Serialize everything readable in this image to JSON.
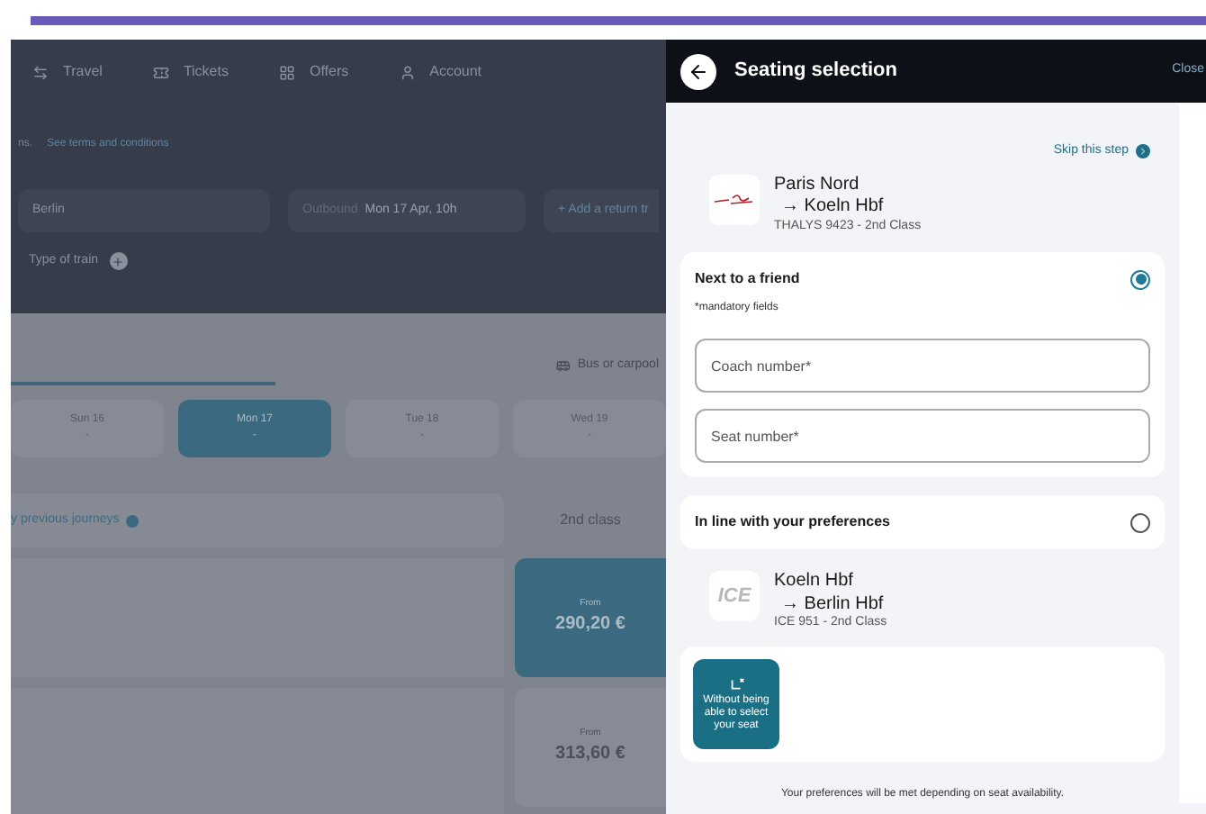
{
  "background": {
    "nav": [
      "Travel",
      "Tickets",
      "Offers",
      "Account"
    ],
    "terms_prefix": "ns.",
    "terms_link": "See terms and conditions",
    "destination": "Berlin",
    "outbound_label": "Outbound",
    "outbound_value": "Mon 17 Apr, 10h",
    "add_return": "+ Add a return tr",
    "filter": "Type of train",
    "transport_tab": "Bus or carpool",
    "dates": [
      {
        "day": "Sun 16",
        "price": "-",
        "selected": false
      },
      {
        "day": "Mon 17",
        "price": "-",
        "selected": true
      },
      {
        "day": "Tue 18",
        "price": "-",
        "selected": false
      },
      {
        "day": "Wed 19",
        "price": "-",
        "selected": false
      }
    ],
    "previous_journeys": "y previous journeys",
    "class_header": "2nd class",
    "fares": [
      {
        "label": "From",
        "price": "290,20 €",
        "selected": true
      },
      {
        "label": "From",
        "price": "313,60 €",
        "selected": false
      }
    ]
  },
  "panel": {
    "title": "Seating selection",
    "close": "Close",
    "skip": "Skip this step",
    "first_leg": {
      "from": "Paris Nord",
      "to": "→ Koeln Hbf",
      "train": "THALYS 9423 - 2nd Class"
    },
    "options": [
      {
        "label": "Next to a friend",
        "selected": true,
        "note": "*mandatory fields",
        "fields": [
          {
            "placeholder": "Coach number*"
          },
          {
            "placeholder": "Seat number*"
          }
        ]
      },
      {
        "label": "In line with your preferences",
        "selected": false
      }
    ],
    "second_leg": {
      "logo_text": "ICE",
      "from": "Koeln Hbf",
      "to": "→ Berlin Hbf",
      "train": "ICE 951 - 2nd Class"
    },
    "seat_choice": {
      "label": "Without being able to select your seat"
    },
    "footnote": "Your preferences will be met depending on seat availability."
  }
}
